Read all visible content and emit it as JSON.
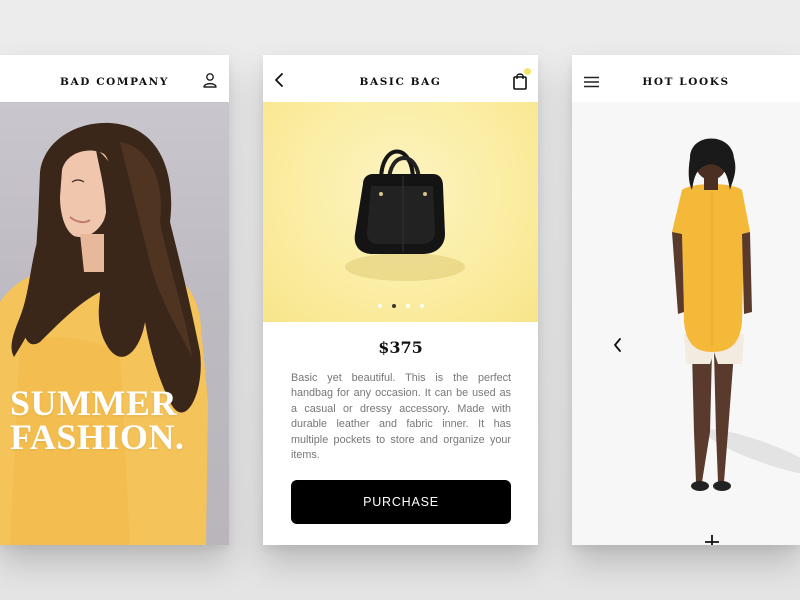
{
  "colors": {
    "accent_yellow": "#f7b733",
    "product_bg": "#fbeda3",
    "button_bg": "#000000",
    "badge": "#f6e36a"
  },
  "screen1": {
    "header": {
      "title": "BAD COMPANY",
      "right_icon": "user-icon"
    },
    "hero": {
      "line1": "SUMMER",
      "line2": "FASHION."
    }
  },
  "screen2": {
    "header": {
      "title": "BASIC BAG",
      "left_icon": "back-arrow-icon",
      "right_icon": "shopping-bag-icon"
    },
    "carousel": {
      "count": 4,
      "active_index": 1
    },
    "price": "$375",
    "description": "Basic yet beautiful. This is the perfect handbag for any occasion.  It can be used  as a casual or dressy accessory. Made with durable leather and fabric inner. It has multiple pockets to store and organize your items.",
    "purchase_label": "PURCHASE"
  },
  "screen3": {
    "header": {
      "title": "HOT LOOKS",
      "left_icon": "hamburger-menu-icon"
    },
    "prev_icon": "chevron-left-icon",
    "add_icon": "plus-icon"
  }
}
